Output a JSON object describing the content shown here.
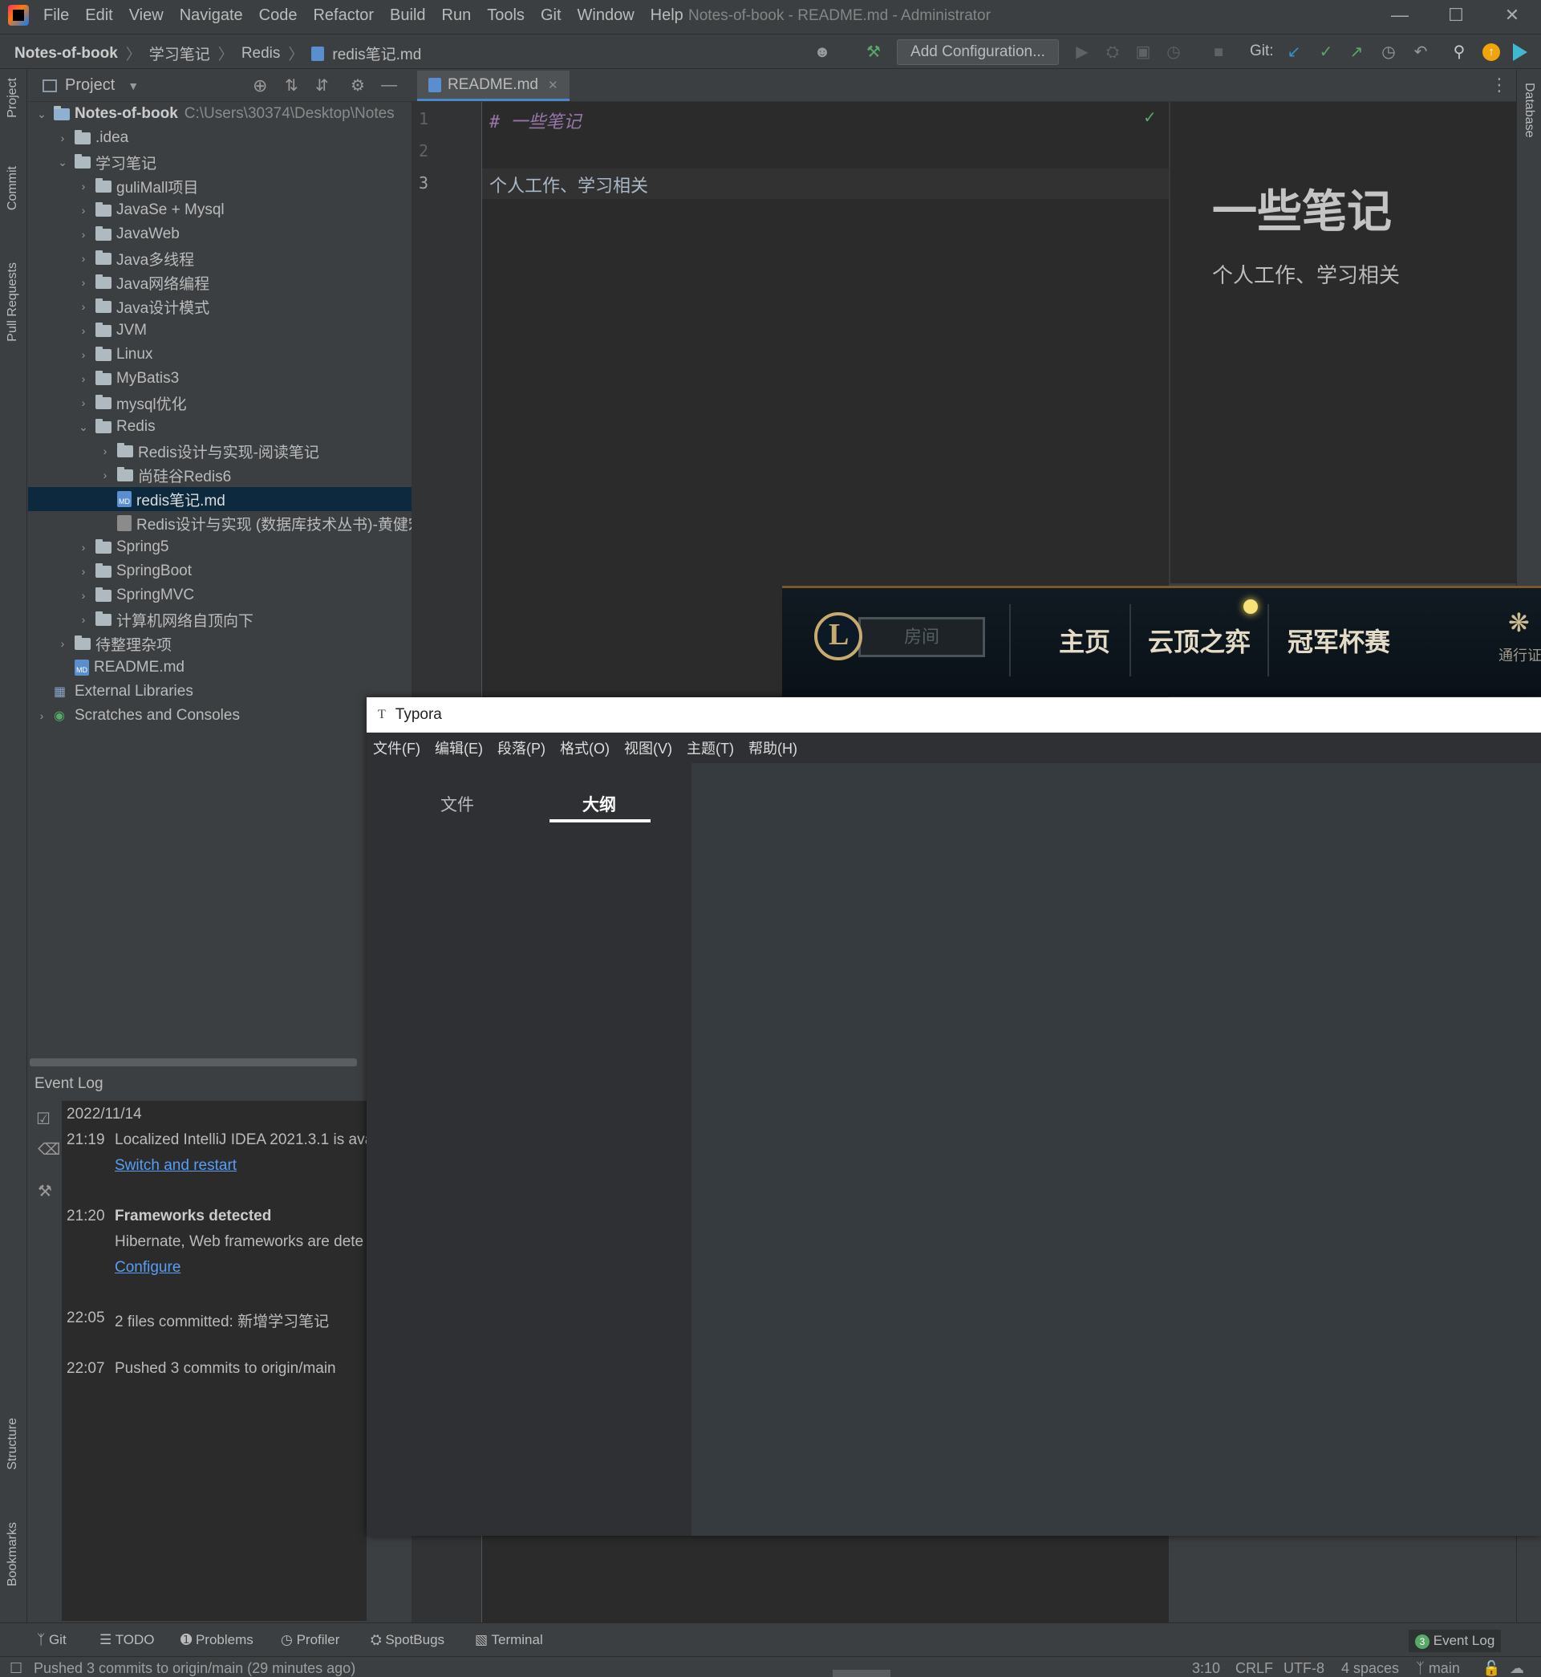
{
  "window": {
    "title": "Notes-of-book - README.md - Administrator",
    "menu": [
      "File",
      "Edit",
      "View",
      "Navigate",
      "Code",
      "Refactor",
      "Build",
      "Run",
      "Tools",
      "Git",
      "Window",
      "Help"
    ]
  },
  "breadcrumb": [
    "Notes-of-book",
    "学习笔记",
    "Redis",
    "redis笔记.md"
  ],
  "toolbar": {
    "add_configuration": "Add Configuration...",
    "git_label": "Git:"
  },
  "left_strip": {
    "project": "Project",
    "commit": "Commit",
    "pull_requests": "Pull Requests",
    "structure": "Structure",
    "bookmarks": "Bookmarks"
  },
  "right_strip": {
    "database": "Database"
  },
  "project": {
    "header": "Project",
    "root": {
      "name": "Notes-of-book",
      "path": "C:\\Users\\30374\\Desktop\\Notes"
    },
    "items": [
      ".idea",
      "学习笔记",
      "guliMall项目",
      "JavaSe + Mysql",
      "JavaWeb",
      "Java多线程",
      "Java网络编程",
      "Java设计模式",
      "JVM",
      "Linux",
      "MyBatis3",
      "mysql优化",
      "Redis",
      "Redis设计与实现-阅读笔记",
      "尚硅谷Redis6",
      "redis笔记.md",
      "Redis设计与实现 (数据库技术丛书)-黄健宏",
      "Spring5",
      "SpringBoot",
      "SpringMVC",
      "计算机网络自顶向下",
      "待整理杂项",
      "README.md",
      "External Libraries",
      "Scratches and Consoles"
    ]
  },
  "editor": {
    "tab": "README.md",
    "lines": [
      {
        "num": "1",
        "text": "# 一些笔记"
      },
      {
        "num": "2",
        "text": ""
      },
      {
        "num": "3",
        "text": "个人工作、学习相关"
      }
    ],
    "preview": {
      "heading": "一些笔记",
      "body": "个人工作、学习相关"
    }
  },
  "lol": {
    "room_placeholder": "房间",
    "nav": [
      "主页",
      "云顶之弈",
      "冠军杯赛"
    ],
    "pass_label": "通行证"
  },
  "typora": {
    "title": "Typora",
    "menu": [
      "文件(F)",
      "编辑(E)",
      "段落(P)",
      "格式(O)",
      "视图(V)",
      "主题(T)",
      "帮助(H)"
    ],
    "tabs": [
      "文件",
      "大纲"
    ],
    "active_tab": "大纲"
  },
  "event_log": {
    "title": "Event Log",
    "date": "2022/11/14",
    "entries": [
      {
        "time": "21:19",
        "text": "Localized IntelliJ IDEA 2021.3.1 is ava",
        "link": "Switch and restart"
      },
      {
        "time": "21:20",
        "title": "Frameworks detected",
        "text": "Hibernate, Web frameworks are dete",
        "link": "Configure"
      },
      {
        "time": "22:05",
        "text": "2 files committed: 新增学习笔记"
      },
      {
        "time": "22:07",
        "text": "Pushed 3 commits to origin/main"
      }
    ]
  },
  "tool_windows": [
    "Git",
    "TODO",
    "Problems",
    "Profiler",
    "SpotBugs",
    "Terminal"
  ],
  "event_log_badge": {
    "count": "3",
    "label": "Event Log"
  },
  "status": {
    "message": "Pushed 3 commits to origin/main (29 minutes ago)",
    "position": "3:10",
    "line_sep": "CRLF",
    "encoding": "UTF-8",
    "indent": "4 spaces",
    "branch": "main"
  },
  "colors": {
    "accent": "#4a88c7",
    "link": "#589df6",
    "lol_gold": "#c8aa6e",
    "selection": "#0d293e"
  }
}
